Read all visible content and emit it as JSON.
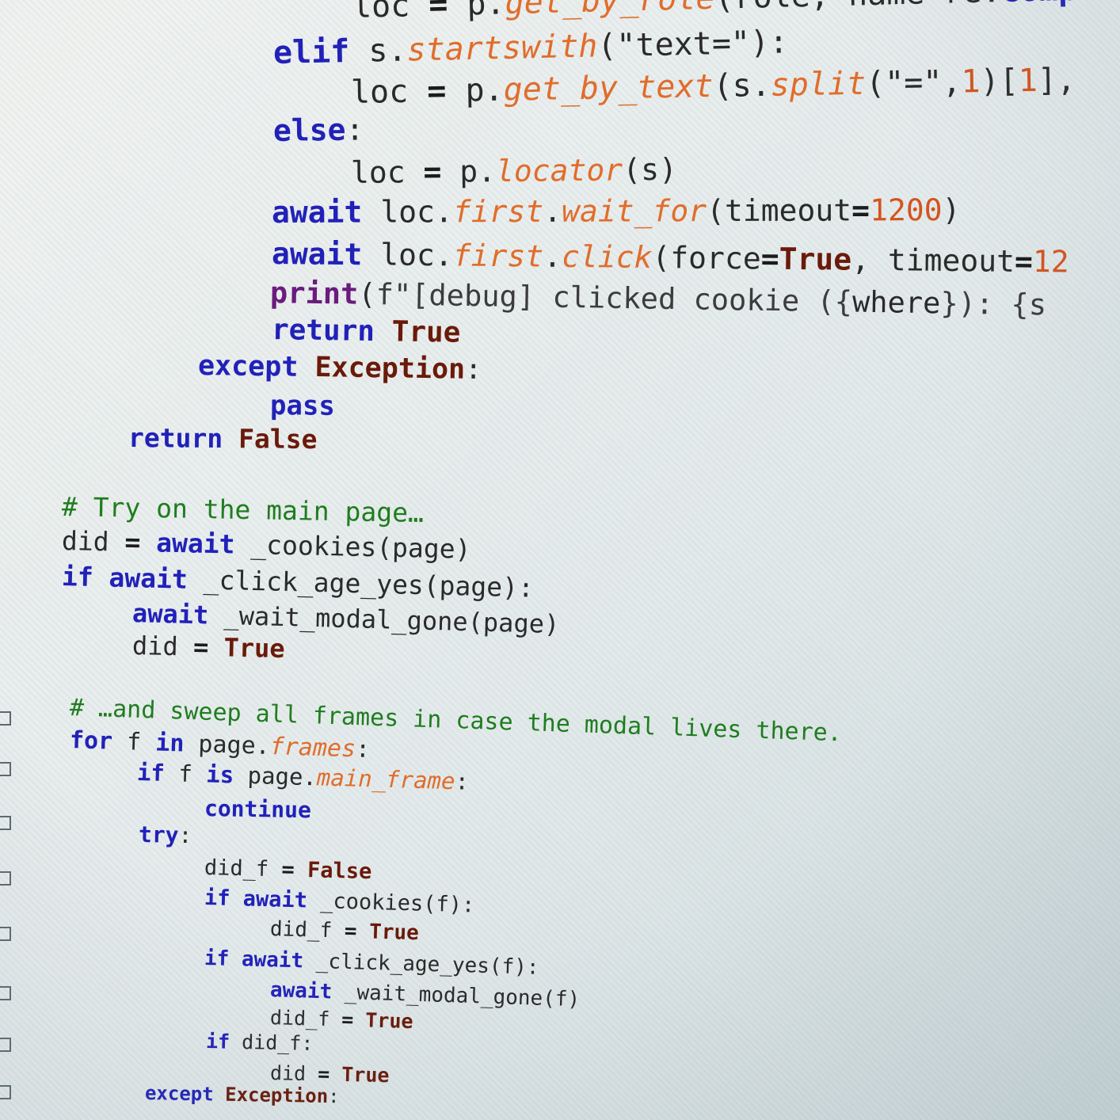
{
  "editor": {
    "lines": [
      {
        "tokens": [
          [
            "fn",
            "loc "
          ],
          [
            "op",
            "= "
          ],
          [
            "fn",
            "p."
          ],
          [
            "at",
            "get_by_role"
          ],
          [
            "fn",
            "(role, name"
          ],
          [
            "op",
            "="
          ],
          [
            "fn",
            "re."
          ],
          [
            "kw",
            "comp"
          ]
        ]
      },
      {
        "tokens": [
          [
            "kw",
            "elif "
          ],
          [
            "fn",
            "s."
          ],
          [
            "at",
            "startswith"
          ],
          [
            "str",
            "(\"text=\"):"
          ]
        ]
      },
      {
        "tokens": [
          [
            "fn",
            "loc "
          ],
          [
            "op",
            "= "
          ],
          [
            "fn",
            "p."
          ],
          [
            "at",
            "get_by_text"
          ],
          [
            "fn",
            "(s."
          ],
          [
            "at",
            "split"
          ],
          [
            "str",
            "(\"=\","
          ],
          [
            "num",
            "1"
          ],
          [
            "fn",
            ")["
          ],
          [
            "num",
            "1"
          ],
          [
            "fn",
            "],"
          ]
        ]
      },
      {
        "tokens": [
          [
            "kw",
            "else"
          ],
          [
            "fn",
            ":"
          ]
        ]
      },
      {
        "tokens": [
          [
            "fn",
            "loc "
          ],
          [
            "op",
            "= "
          ],
          [
            "fn",
            "p."
          ],
          [
            "at",
            "locator"
          ],
          [
            "fn",
            "(s)"
          ]
        ]
      },
      {
        "tokens": [
          [
            "kw",
            "await "
          ],
          [
            "fn",
            "loc."
          ],
          [
            "at",
            "first"
          ],
          [
            "fn",
            "."
          ],
          [
            "at",
            "wait_for"
          ],
          [
            "fn",
            "(timeout"
          ],
          [
            "op",
            "="
          ],
          [
            "num",
            "1200"
          ],
          [
            "fn",
            ")"
          ]
        ]
      },
      {
        "tokens": [
          [
            "kw",
            "await "
          ],
          [
            "fn",
            "loc."
          ],
          [
            "at",
            "first"
          ],
          [
            "fn",
            "."
          ],
          [
            "at",
            "click"
          ],
          [
            "fn",
            "(force"
          ],
          [
            "op",
            "="
          ],
          [
            "lit",
            "True"
          ],
          [
            "fn",
            ", timeout"
          ],
          [
            "op",
            "="
          ],
          [
            "num",
            "12"
          ]
        ]
      },
      {
        "tokens": [
          [
            "pr",
            "print"
          ],
          [
            "fn",
            "("
          ],
          [
            "fstr",
            "f\"[debug] clicked cookie ({"
          ],
          [
            "fn",
            "where"
          ],
          [
            "fstr",
            "}): {s"
          ]
        ]
      },
      {
        "tokens": [
          [
            "kw",
            "return "
          ],
          [
            "lit",
            "True"
          ]
        ]
      },
      {
        "tokens": [
          [
            "kw",
            "except "
          ],
          [
            "lit",
            "Exception"
          ],
          [
            "fn",
            ":"
          ]
        ]
      },
      {
        "tokens": [
          [
            "kw",
            "pass"
          ]
        ]
      },
      {
        "tokens": [
          [
            "kw",
            "return "
          ],
          [
            "lit",
            "False"
          ]
        ]
      },
      {
        "tokens": [
          [
            "cm",
            "# Try on the main page…"
          ]
        ]
      },
      {
        "tokens": [
          [
            "fn",
            "did "
          ],
          [
            "op",
            "= "
          ],
          [
            "kw",
            "await "
          ],
          [
            "fn",
            "_cookies(page)"
          ]
        ]
      },
      {
        "tokens": [
          [
            "kw",
            "if await "
          ],
          [
            "fn",
            "_click_age_yes(page):"
          ]
        ]
      },
      {
        "tokens": [
          [
            "kw",
            "await "
          ],
          [
            "fn",
            "_wait_modal_gone(page)"
          ]
        ]
      },
      {
        "tokens": [
          [
            "fn",
            "did "
          ],
          [
            "op",
            "= "
          ],
          [
            "lit",
            "True"
          ]
        ]
      },
      {
        "tokens": [
          [
            "cm",
            "# …and sweep all frames in case the modal lives there."
          ]
        ]
      },
      {
        "tokens": [
          [
            "kw",
            "for "
          ],
          [
            "fn",
            "f "
          ],
          [
            "kw",
            "in "
          ],
          [
            "fn",
            "page."
          ],
          [
            "at",
            "frames"
          ],
          [
            "fn",
            ":"
          ]
        ]
      },
      {
        "tokens": [
          [
            "kw",
            "if "
          ],
          [
            "fn",
            "f "
          ],
          [
            "kw",
            "is "
          ],
          [
            "fn",
            "page."
          ],
          [
            "at",
            "main_frame"
          ],
          [
            "fn",
            ":"
          ]
        ]
      },
      {
        "tokens": [
          [
            "kw",
            "continue"
          ]
        ]
      },
      {
        "tokens": [
          [
            "kw",
            "try"
          ],
          [
            "fn",
            ":"
          ]
        ]
      },
      {
        "tokens": [
          [
            "fn",
            "did_f "
          ],
          [
            "op",
            "= "
          ],
          [
            "lit",
            "False"
          ]
        ]
      },
      {
        "tokens": [
          [
            "kw",
            "if await "
          ],
          [
            "fn",
            "_cookies(f):"
          ]
        ]
      },
      {
        "tokens": [
          [
            "fn",
            "did_f "
          ],
          [
            "op",
            "= "
          ],
          [
            "lit",
            "True"
          ]
        ]
      },
      {
        "tokens": [
          [
            "kw",
            "if await "
          ],
          [
            "fn",
            "_click_age_yes(f):"
          ]
        ]
      },
      {
        "tokens": [
          [
            "kw",
            "await "
          ],
          [
            "fn",
            "_wait_modal_gone(f)"
          ]
        ]
      },
      {
        "tokens": [
          [
            "fn",
            "did_f "
          ],
          [
            "op",
            "= "
          ],
          [
            "lit",
            "True"
          ]
        ]
      },
      {
        "tokens": [
          [
            "kw",
            "if "
          ],
          [
            "fn",
            "did_f:"
          ]
        ]
      },
      {
        "tokens": [
          [
            "fn",
            "did "
          ],
          [
            "op",
            "= "
          ],
          [
            "lit",
            "True"
          ]
        ]
      },
      {
        "tokens": [
          [
            "kw",
            "except "
          ],
          [
            "lit",
            "Exception"
          ],
          [
            "fn",
            ":"
          ]
        ]
      }
    ]
  }
}
